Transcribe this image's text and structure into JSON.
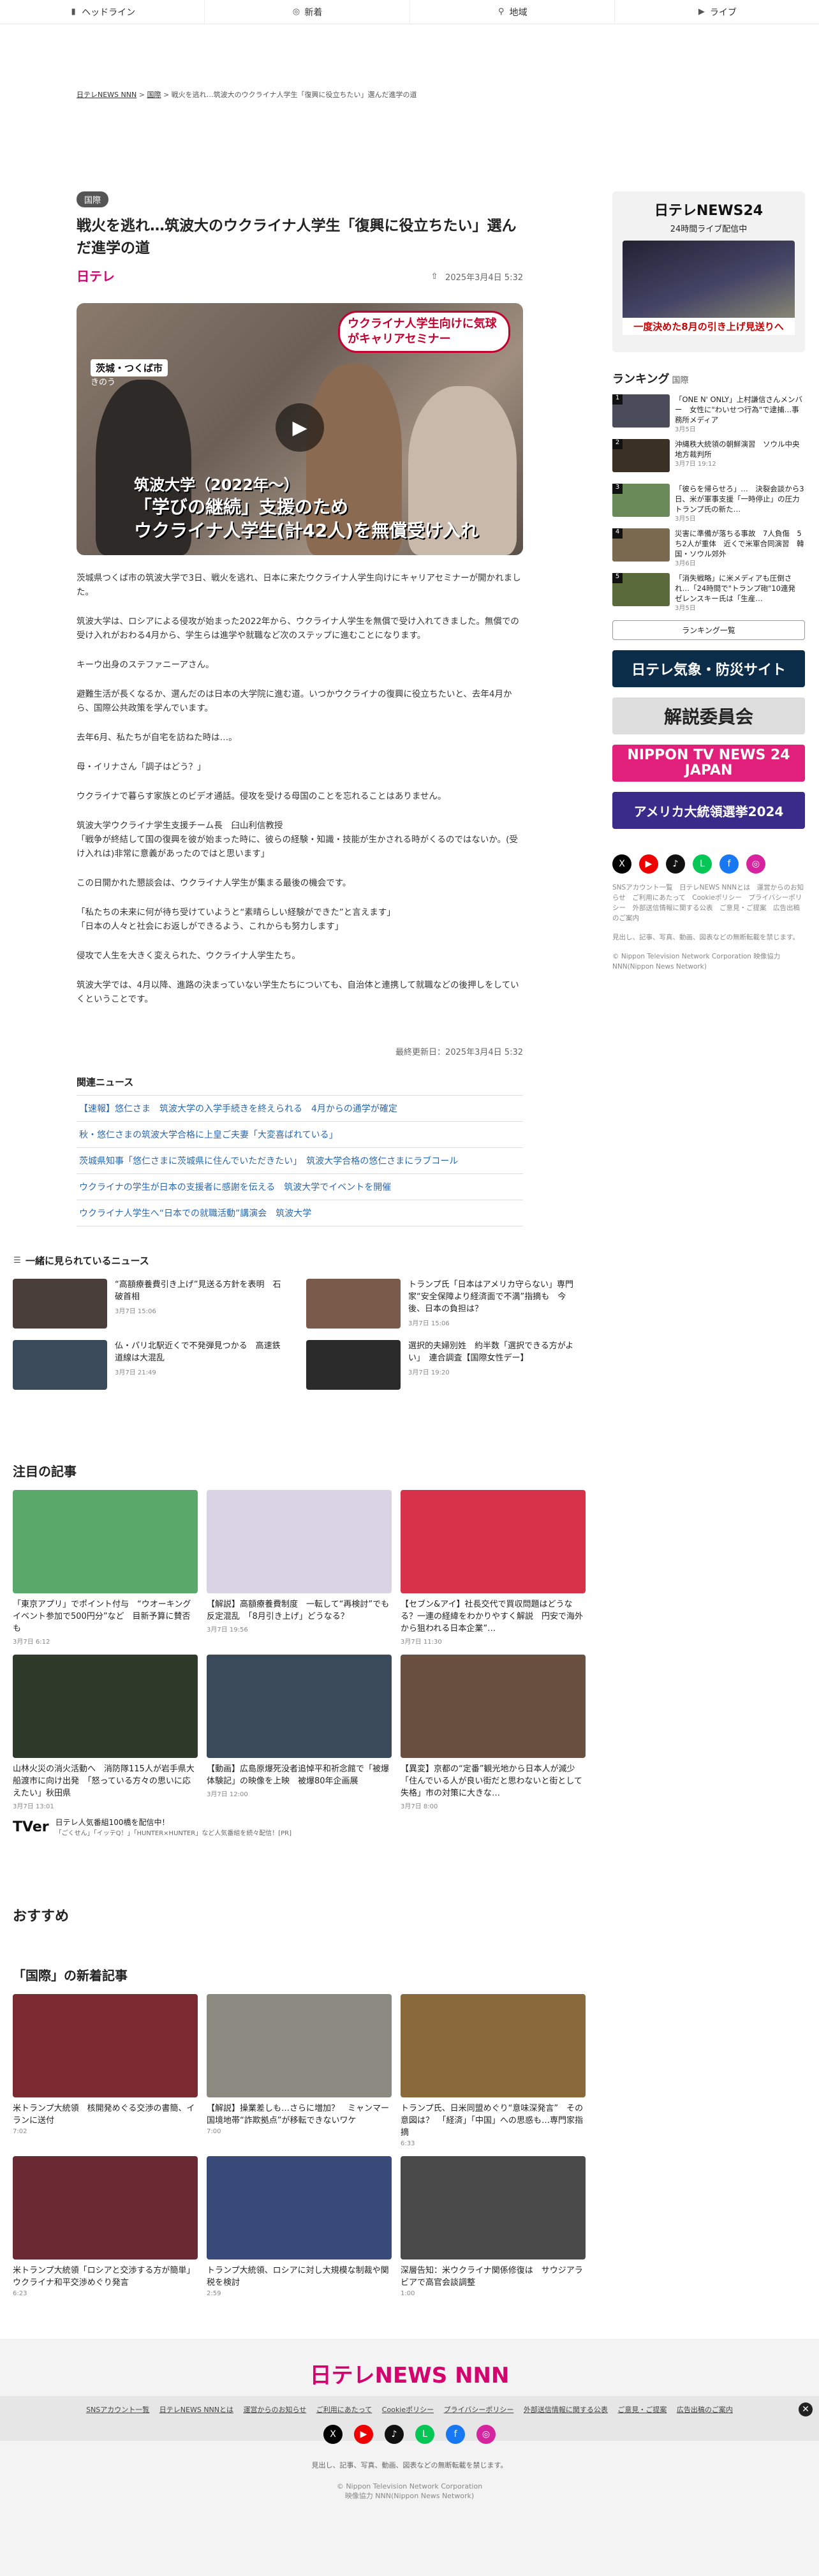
{
  "nav": {
    "items": [
      {
        "label": "ヘッドライン",
        "icon": "headline-icon"
      },
      {
        "label": "新着",
        "icon": "new-icon"
      },
      {
        "label": "地域",
        "icon": "pin-icon"
      },
      {
        "label": "ライブ",
        "icon": "live-icon"
      }
    ]
  },
  "breadcrumb": {
    "home": "日テレNEWS NNN",
    "section": "国際",
    "current": "戦火を逃れ…筑波大のウクライナ人学生「復興に役立ちたい」選んだ進学の道"
  },
  "article": {
    "category": "国際",
    "title": "戦火を逃れ…筑波大のウクライナ人学生「復興に役立ちたい」選んだ進学の道",
    "source": "日テレ",
    "date": "2025年3月4日 5:32",
    "hero": {
      "location": "茨城・つくば市",
      "location_sub": "きのう",
      "telop": "ウクライナ人学生向けに気球がキャリアセミナー",
      "cap1": "筑波大学（2022年〜）",
      "cap2": "「学びの継続」支援のため",
      "cap3": "ウクライナ人学生(計42人)を無償受け入れ"
    },
    "paragraphs": [
      "茨城県つくば市の筑波大学で3日、戦火を逃れ、日本に来たウクライナ人学生向けにキャリアセミナーが開かれました。",
      "筑波大学は、ロシアによる侵攻が始まった2022年から、ウクライナ人学生を無償で受け入れてきました。無償での受け入れがおわる4月から、学生らは進学や就職など次のステップに進むことになります。",
      "キーウ出身のステファニーアさん。",
      "避難生活が長くなるか、選んだのは日本の大学院に進む道。いつかウクライナの復興に役立ちたいと、去年4月から、国際公共政策を学んでいます。",
      "去年6月、私たちが自宅を訪ねた時は…。",
      "母・イリナさん「調子はどう？」",
      "ウクライナで暮らす家族とのビデオ通話。侵攻を受ける母国のことを忘れることはありません。",
      "筑波大学ウクライナ学生支援チーム長　臼山利信教授\n「戦争が終結して国の復興を彼が始まった時に、彼らの経験・知識・技能が生かされる時がくるのではないか。(受け入れは)非常に意義があったのではと思います」",
      "この日開かれた懇談会は、ウクライナ人学生が集まる最後の機会です。",
      "「私たちの未来に何が待ち受けていようと“素晴らしい経験ができた”と言えます」\n「日本の人々と社会にお返しができるよう、これからも努力します」",
      "侵攻で人生を大きく変えられた、ウクライナ人学生たち。",
      "筑波大学では、4月以降、進路の決まっていない学生たちについても、自治体と連携して就職などの後押しをしていくということです。"
    ],
    "updated": "最終更新日：2025年3月4日 5:32"
  },
  "related": {
    "heading": "関連ニュース",
    "items": [
      "【速報】悠仁さま　筑波大学の入学手続きを終えられる　4月からの通学が確定",
      "秋・悠仁さまの筑波大学合格に上皇ご夫妻「大変喜ばれている」",
      "茨城県知事「悠仁さまに茨城県に住んでいただきたい」　筑波大学合格の悠仁さまにラブコール",
      "ウクライナの学生が日本の支援者に感謝を伝える　筑波大学でイベントを開催",
      "ウクライナ人学生へ“日本での就職活動”講演会　筑波大学"
    ]
  },
  "sidebar": {
    "live": {
      "logo": "日テレNEWS24",
      "sub": "24時間ライブ配信中",
      "strip": "一度決めた8月の引き上げ見送りへ"
    },
    "ranking": {
      "heading": "ランキング",
      "tag": "国際",
      "items": [
        {
          "title": "「ONE N' ONLY」上村謙信さんメンバー　女性に\"わいせつ行為\"で逮捕…事務所メディア",
          "date": "3月5日"
        },
        {
          "title": "沖縄秩大統領の朝鮮演習　ソウル中央地方裁判所",
          "date": "3月7日 19:12"
        },
        {
          "title": "「彼らを帰らせろ」…　決裂会談から3日、米が軍事支援「一時停止」の圧力　トランプ氏の新た…",
          "date": "3月5日"
        },
        {
          "title": "災害に準備が落ちる事故　7人負傷　5ち2人が重体　近くで米軍合同演習　韓国・ソウル郊外",
          "date": "3月6日"
        },
        {
          "title": "「消失戦略」に米メディアも圧倒され…「24時間で\"トランプ砲\"10連発　ゼレンスキー氏は「生産…",
          "date": "3月5日"
        }
      ],
      "more": "ランキング一覧"
    },
    "banners": [
      {
        "label": "日テレ気象・防災サイト"
      },
      {
        "label": "解説委員会"
      },
      {
        "label": "NIPPON TV NEWS 24 JAPAN"
      },
      {
        "label": "アメリカ大統領選挙2024"
      }
    ],
    "social": [
      "X",
      "YouTube",
      "TikTok",
      "LINE",
      "Facebook",
      "Instagram"
    ],
    "note1": "SNSアカウント一覧　日テレNEWS NNNとは　運営からのお知らせ　ご利用にあたって　Cookieポリシー　プライバシーポリシー　外部送信情報に関する公表　ご意見・ご提案　広告出稿のご案内",
    "note2": "見出し、記事、写真、動画、図表などの無断転載を禁じます。",
    "copyright": "© Nippon Television Network Corporation 映像協力 NNN(Nippon News Network)"
  },
  "together": {
    "heading": "一緒に見られているニュース",
    "items": [
      {
        "title": "“高額療養費引き上げ”見送る方針を表明　石破首相",
        "date": "3月7日 15:06"
      },
      {
        "title": "トランプ氏「日本はアメリカ守らない」専門家“安全保障より経済面で不満”指摘も　今後、日本の負担は？",
        "date": "3月7日 15:06"
      },
      {
        "title": "仏・パリ北駅近くで不発弾見つかる　高速鉄道線は大混乱",
        "date": "3月7日 21:49"
      },
      {
        "title": "選択的夫婦別姓　約半数「選択できる方がよい」　連合調査【国際女性デー】",
        "date": "3月7日 19:20"
      }
    ]
  },
  "pickup": {
    "heading": "注目の記事",
    "items": [
      {
        "title": "「東京アプリ」でポイント付与　“ウオーキングイベント参加で500円分”など　目新予算に賛否も",
        "date": "3月7日 6:12"
      },
      {
        "title": "【解説】高額療養費制度　一転して“再検討”でも反定混乱　「8月引き上げ」どうなる？",
        "date": "3月7日 19:56"
      },
      {
        "title": "【セブン&アイ】社長交代で買収問題はどうなる？一連の経緯をわかりやすく解説　円安で海外から狙われる日本企業”…",
        "date": "3月7日 11:30"
      },
      {
        "title": "山林火災の消火活動へ　消防隊115人が岩手県大船渡市に向け出発　「怒っている方々の思いに応えたい」秋田県",
        "date": "3月7日 13:01"
      },
      {
        "title": "【動画】広島原爆死没者追悼平和祈念館で「被爆体験記」の映像を上映　被爆80年企画展",
        "date": "3月7日 12:00"
      },
      {
        "title": "【異変】京都の“定番”観光地から日本人が減少　「住んでいる人が良い街だと思わないと街として失格」市の対策に大きな…",
        "date": "3月7日 8:00"
      }
    ],
    "tver": {
      "logo": "TVer",
      "title": "日テレ人気番組100橋を配信中！",
      "sub": "「ごくせん」「イッテQ！」「HUNTER×HUNTER」など人気番組を続々配信！[PR]"
    }
  },
  "recommend": {
    "heading": "おすすめ"
  },
  "intl": {
    "heading": "「国際」の新着記事",
    "items": [
      {
        "title": "米トランプ大統領　核開発めぐる交渉の書簡、イランに送付",
        "date": "7:02"
      },
      {
        "title": "【解説】操業差しも…さらに増加？　ミャンマー国境地帯“詐欺拠点”が移転できないワケ",
        "date": "7:00"
      },
      {
        "title": "トランプ氏、日米同盟めぐり“意味深発言”　その意図は？　「経済」「中国」への思惑も…専門家指摘",
        "date": "6:33"
      },
      {
        "title": "米トランプ大統領「ロシアと交渉する方が簡単」ウクライナ和平交渉めぐり発言",
        "date": "6:23"
      },
      {
        "title": "トランプ大統領、ロシアに対し大規模な制裁や関税を検討",
        "date": "2:59"
      },
      {
        "title": "深層告知：米ウクライナ関係修復は　サウジアラビアで高官会談調整",
        "date": "1:00"
      }
    ]
  },
  "footer": {
    "logo": "日テレNEWS NNN",
    "links": [
      "SNSアカウント一覧",
      "日テレNEWS NNNとは",
      "運営からのお知らせ",
      "ご利用にあたって",
      "Cookieポリシー",
      "プライバシーポリシー",
      "外部送信情報に関する公表",
      "ご意見・ご提案",
      "広告出稿のご案内"
    ],
    "note": "見出し、記事、写真、動画、図表などの無断転載を禁じます。",
    "copy1": "© Nippon Television Network Corporation",
    "copy2": "映像協力 NNN(Nippon News Network)"
  }
}
